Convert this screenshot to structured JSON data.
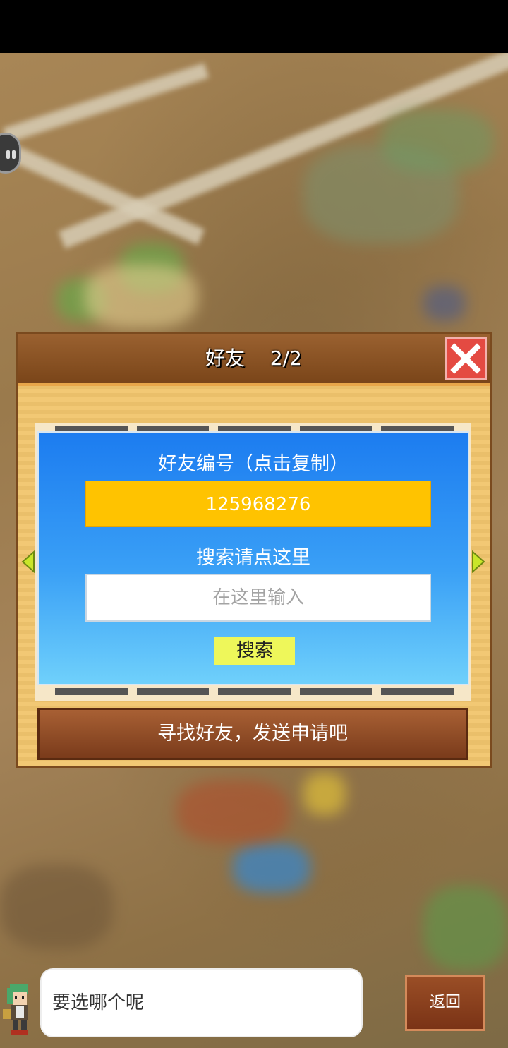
{
  "dialog": {
    "title": "好友    2/2",
    "close_icon": "close-x-icon"
  },
  "card": {
    "id_label": "好友编号（点击复制）",
    "friend_id": "125968276",
    "search_label": "搜索请点这里",
    "search_placeholder": "在这里输入",
    "search_button": "搜索"
  },
  "banner": {
    "text": "寻找好友，发送申请吧"
  },
  "footer": {
    "speech": "要选哪个呢",
    "back_button": "返回"
  },
  "colors": {
    "card_top": "#1c7cf0",
    "id_box": "#ffc300",
    "search_button": "#eef75a",
    "close_button": "#e44a42"
  }
}
